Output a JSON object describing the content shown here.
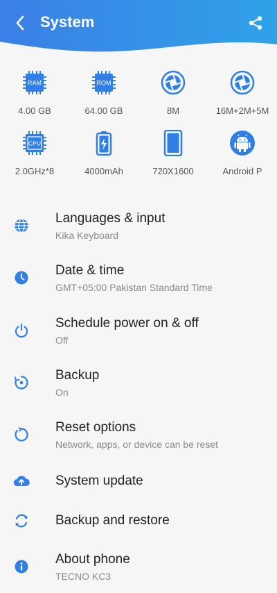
{
  "header": {
    "title": "System"
  },
  "specs": [
    {
      "icon": "ram-chip-icon",
      "chip": "RAM",
      "label": "4.00 GB"
    },
    {
      "icon": "rom-chip-icon",
      "chip": "ROM",
      "label": "64.00 GB"
    },
    {
      "icon": "front-camera-icon",
      "label": "8M"
    },
    {
      "icon": "rear-camera-icon",
      "label": "16M+2M+5M"
    },
    {
      "icon": "cpu-chip-icon",
      "chip": "CPU",
      "label": "2.0GHz*8"
    },
    {
      "icon": "battery-icon",
      "label": "4000mAh"
    },
    {
      "icon": "screen-icon",
      "label": "720X1600"
    },
    {
      "icon": "android-icon",
      "label": "Android P"
    }
  ],
  "menu": [
    {
      "icon": "globe-icon",
      "title": "Languages & input",
      "subtitle": "Kika Keyboard"
    },
    {
      "icon": "clock-icon",
      "title": "Date & time",
      "subtitle": "GMT+05:00 Pakistan Standard Time"
    },
    {
      "icon": "power-icon",
      "title": "Schedule power on & off",
      "subtitle": "Off"
    },
    {
      "icon": "backup-icon",
      "title": "Backup",
      "subtitle": "On"
    },
    {
      "icon": "reset-icon",
      "title": "Reset options",
      "subtitle": "Network, apps, or device can be reset"
    },
    {
      "icon": "cloud-upload-icon",
      "title": "System update"
    },
    {
      "icon": "sync-icon",
      "title": "Backup and restore"
    },
    {
      "icon": "info-icon",
      "title": "About phone",
      "subtitle": "TECNO KC3"
    }
  ],
  "colors": {
    "accent": "#2f7fe4",
    "header_start": "#3a84e8",
    "header_end": "#2c9fe6"
  }
}
